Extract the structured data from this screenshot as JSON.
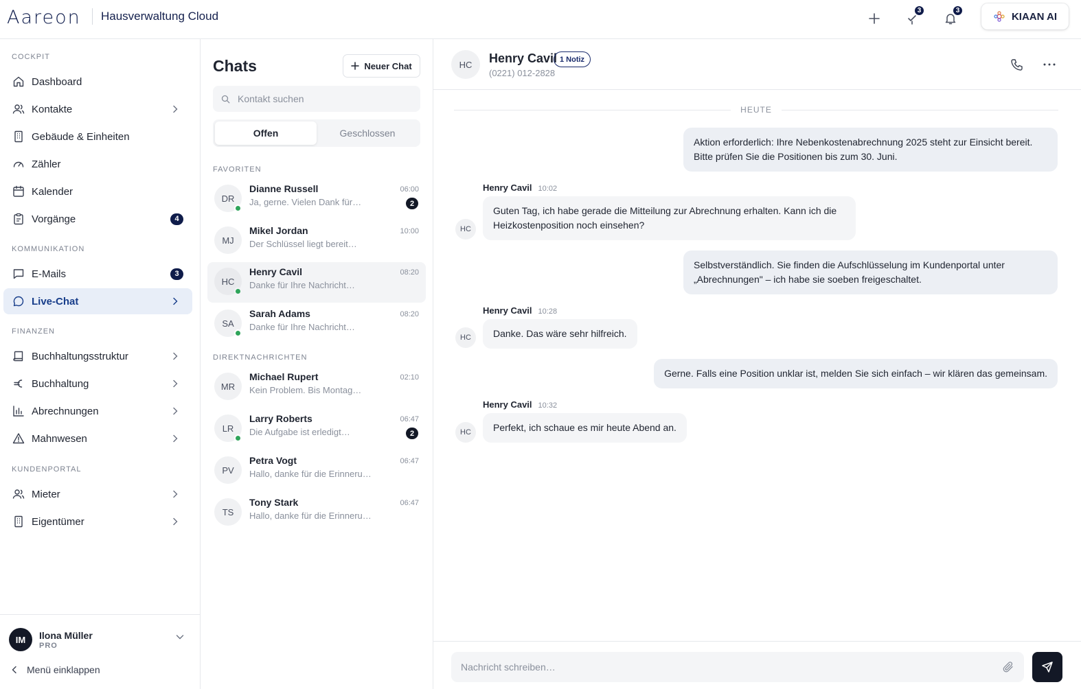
{
  "topbar": {
    "logo": "Aareon",
    "app_name": "Hausverwaltung Cloud",
    "tasks_count": "3",
    "notifications_count": "3",
    "ai_label": "KIAAN AI"
  },
  "sidebar": {
    "sections": {
      "cockpit": "COCKPIT",
      "kommunikation": "KOMMUNIKATION",
      "finanzen": "FINANZEN",
      "kundenportal": "KUNDENPORTAL"
    },
    "items": {
      "dashboard": "Dashboard",
      "kontakte": "Kontakte",
      "gebaeude": "Gebäude & Einheiten",
      "zaehler": "Zähler",
      "kalender": "Kalender",
      "vorgaenge": "Vorgänge",
      "vorgaenge_badge": "4",
      "emails": "E-Mails",
      "emails_badge": "3",
      "livechat": "Live-Chat",
      "buchhaltungsstruktur": "Buchhaltungsstruktur",
      "buchhaltung": "Buchhaltung",
      "abrechnungen": "Abrechnungen",
      "mahnwesen": "Mahnwesen",
      "mieter": "Mieter",
      "eigentuemer": "Eigentümer"
    },
    "user": {
      "initials": "IM",
      "name": "Ilona Müller",
      "role": "PRO"
    },
    "collapse_label": "Menü einklappen"
  },
  "chatlist": {
    "title": "Chats",
    "new_chat": "Neuer Chat",
    "search_placeholder": "Kontakt suchen",
    "tabs": {
      "open": "Offen",
      "closed": "Geschlossen"
    },
    "favorites_title": "FAVORITEN",
    "direct_title": "DIREKTNACHRICHTEN",
    "favorites": [
      {
        "initials": "DR",
        "name": "Dianne Russell",
        "preview": "Ja, gerne. Vielen Dank für…",
        "time": "06:00",
        "unread": "2",
        "online": true
      },
      {
        "initials": "MJ",
        "name": "Mikel Jordan",
        "preview": "Der Schlüssel liegt bereit…",
        "time": "10:00",
        "online": false
      },
      {
        "initials": "HC",
        "name": "Henry Cavil",
        "preview": "Danke für Ihre Nachricht…",
        "time": "08:20",
        "online": true
      },
      {
        "initials": "SA",
        "name": "Sarah Adams",
        "preview": "Danke für Ihre Nachricht…",
        "time": "08:20",
        "online": true
      }
    ],
    "direct": [
      {
        "initials": "MR",
        "name": "Michael Rupert",
        "preview": "Kein Problem. Bis Montag…",
        "time": "02:10",
        "online": false
      },
      {
        "initials": "LR",
        "name": "Larry Roberts",
        "preview": "Die Aufgabe ist erledigt…",
        "time": "06:47",
        "unread": "2",
        "online": true
      },
      {
        "initials": "PV",
        "name": "Petra Vogt",
        "preview": "Hallo, danke für die Erinnerung…",
        "time": "06:47",
        "online": false
      },
      {
        "initials": "TS",
        "name": "Tony Stark",
        "preview": "Hallo, danke für die Erinnerung…",
        "time": "06:47",
        "online": false
      }
    ]
  },
  "conversation": {
    "contact": {
      "initials": "HC",
      "name": "Henry Cavil",
      "note_badge": "1 Notiz",
      "phone": "(0221) 012-2828"
    },
    "day_label": "HEUTE",
    "messages": {
      "out1": "Aktion erforderlich: Ihre Nebenkostenabrechnung 2025 steht zur Einsicht bereit. Bitte prüfen Sie die Positionen bis zum 30. Juni.",
      "in1": {
        "sender": "Henry Cavil",
        "time": "10:02",
        "text": "Guten Tag, ich habe gerade die Mitteilung zur Abrechnung erhalten. Kann ich die Heizkostenposition noch einsehen?"
      },
      "out2": "Selbstverständlich. Sie finden die Aufschlüsselung im Kundenportal unter „Abrechnungen\" – ich habe sie soeben freigeschaltet.",
      "in2": {
        "sender": "Henry Cavil",
        "time": "10:28",
        "text": "Danke. Das wäre sehr hilfreich."
      },
      "out3": "Gerne. Falls eine Position unklar ist, melden Sie sich einfach – wir klären das gemeinsam.",
      "in3": {
        "sender": "Henry Cavil",
        "time": "10:32",
        "text": "Perfekt, ich schaue es mir heute Abend an."
      }
    },
    "composer_placeholder": "Nachricht schreiben…"
  }
}
